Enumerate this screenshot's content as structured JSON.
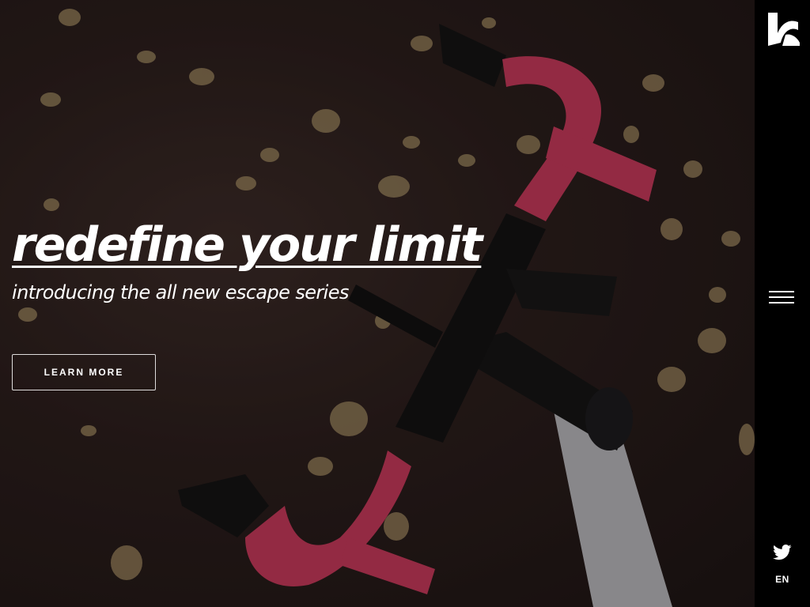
{
  "hero": {
    "headline": "redefine your limit",
    "subheadline": "introducing the all new escape series",
    "cta_label": "LEARN MORE"
  },
  "sidebar": {
    "logo_icon": "brand-logo-icon",
    "menu_icon": "hamburger-menu-icon",
    "social_icon": "twitter-icon",
    "language": "EN"
  },
  "colors": {
    "background": "#000000",
    "text": "#ffffff",
    "handlebar_tape": "#c8385a",
    "ground": "#2a1d1b",
    "leaf": "#b9a274"
  }
}
